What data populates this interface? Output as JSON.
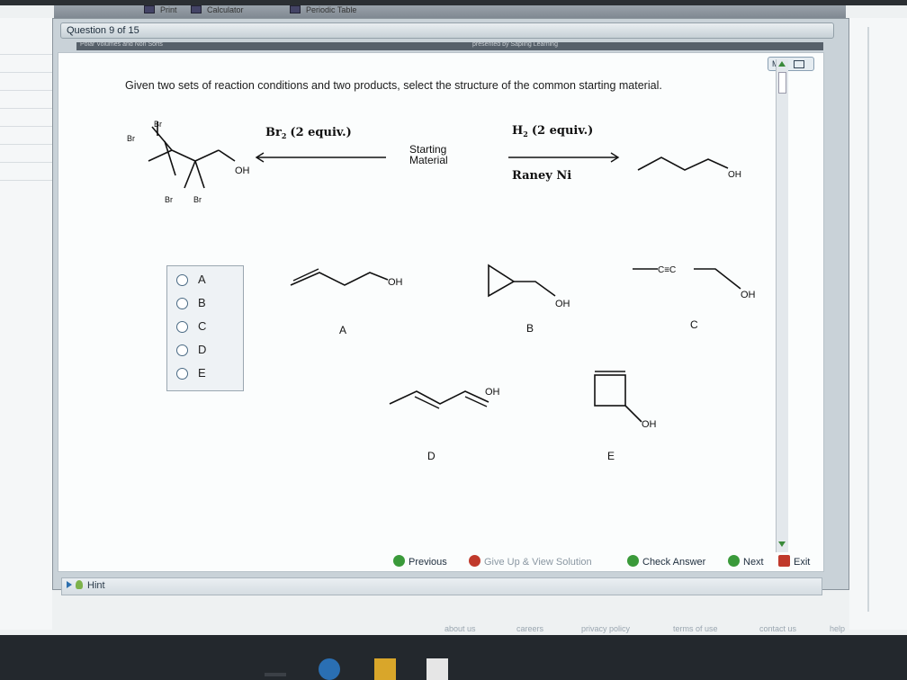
{
  "browser": {
    "tab_print": "Print",
    "tab_calculator": "Calculator",
    "tab_periodic": "Periodic Table"
  },
  "header": {
    "question_counter": "Question 9 of 15",
    "strip_left": "Polar Volumes and Non Sorts",
    "strip_right": "presented by Sapling Learning"
  },
  "map_button": "Map",
  "question_text": "Given two sets of reaction conditions and two products, select the structure of the common starting material.",
  "scheme": {
    "left_reagent": "Br",
    "left_reagent_sub": "2",
    "left_equiv": "(2 equiv.)",
    "center_label_1": "Starting",
    "center_label_2": "Material",
    "right_reagent": "H",
    "right_reagent_sub": "2",
    "right_equiv": "(2 equiv.)",
    "right_catalyst": "Raney Ni",
    "product_left_oh": "OH",
    "product_left_br": "Br",
    "product_right_oh": "OH"
  },
  "choices": [
    {
      "label": "A"
    },
    {
      "label": "B"
    },
    {
      "label": "C"
    },
    {
      "label": "D"
    },
    {
      "label": "E"
    }
  ],
  "structures": {
    "A": {
      "label": "A",
      "oh": "OH"
    },
    "B": {
      "label": "B",
      "oh": "OH"
    },
    "C": {
      "label": "C",
      "oh": "OH",
      "triple": "C≡C"
    },
    "D": {
      "label": "D",
      "oh": "OH"
    },
    "E": {
      "label": "E",
      "oh": "OH"
    }
  },
  "nav": {
    "previous": "Previous",
    "give_up": "Give Up & View Solution",
    "check": "Check Answer",
    "next": "Next",
    "exit": "Exit"
  },
  "hint": "Hint",
  "footer": {
    "about": "about us",
    "careers": "careers",
    "privacy": "privacy policy",
    "terms": "terms of use",
    "contact": "contact us",
    "help": "help"
  },
  "colors": {
    "accent_green": "#3a9a3a",
    "give_up_red": "#c0392b",
    "exit_red": "#c0392b"
  }
}
